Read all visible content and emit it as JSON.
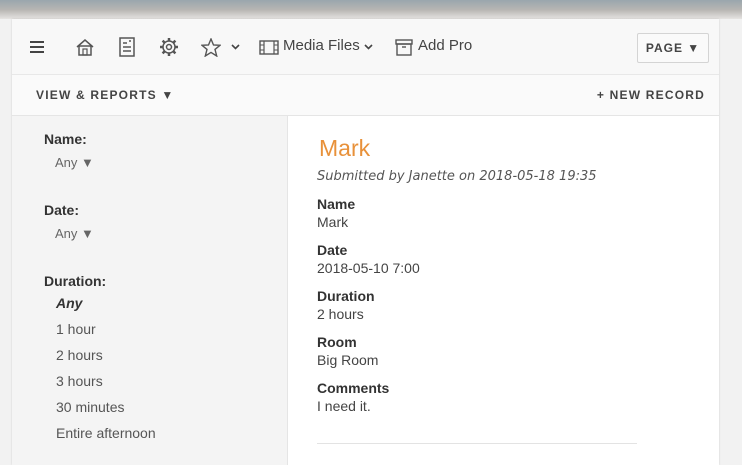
{
  "toolbar": {
    "icons": [
      "menu-icon",
      "home-icon",
      "form-icon",
      "gear-icon",
      "star-icon",
      "chevron-down-icon",
      "film-icon",
      "archive-icon"
    ],
    "media_files_label": "Media Files",
    "add_pro_label": "Add Pro",
    "page_label": "PAGE ▼"
  },
  "subbar": {
    "view_reports": "VIEW & REPORTS ▼",
    "new_record": "+ NEW RECORD"
  },
  "filters": {
    "name": {
      "label": "Name:",
      "value": "Any ▼"
    },
    "date": {
      "label": "Date:",
      "value": "Any ▼"
    },
    "duration": {
      "label": "Duration:",
      "options": [
        "Any",
        "1 hour",
        "2 hours",
        "3 hours",
        "30 minutes",
        "Entire afternoon"
      ],
      "selected": "Any"
    }
  },
  "record": {
    "title": "Mark",
    "submitted": "Submitted by Janette on 2018-05-18 19:35",
    "fields": [
      {
        "label": "Name",
        "value": "Mark"
      },
      {
        "label": "Date",
        "value": "2018-05-10 7:00"
      },
      {
        "label": "Duration",
        "value": "2 hours"
      },
      {
        "label": "Room",
        "value": "Big Room"
      },
      {
        "label": "Comments",
        "value": "I need it."
      }
    ]
  },
  "colors": {
    "accent": "#e8913a",
    "sidebar_bg": "#f4f4f4",
    "toolbar_bg": "#f8f8f8"
  }
}
